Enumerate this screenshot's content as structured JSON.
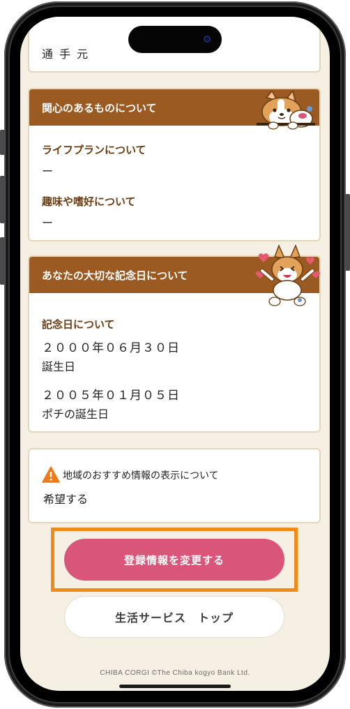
{
  "top_partial_text": "通 手 元",
  "interests_card": {
    "title": "関心のあるものについて",
    "items": [
      {
        "label": "ライフプランについて",
        "value": "ー"
      },
      {
        "label": "趣味や嗜好について",
        "value": "ー"
      }
    ]
  },
  "anniversary_card": {
    "title": "あなたの大切な記念日について",
    "label": "記念日について",
    "entries": [
      {
        "date": "２０００年０６月３０日",
        "name": "誕生日"
      },
      {
        "date": "２００５年０１月０５日",
        "name": "ポチの誕生日"
      }
    ]
  },
  "region_card": {
    "label": "地域のおすすめ情報の表示について",
    "value": "希望する"
  },
  "buttons": {
    "primary": "登録情報を変更する",
    "secondary": "生活サービス　トップ"
  },
  "footer": "CHIBA CORGI ©The Chiba kogyo Bank Ltd.",
  "colors": {
    "background": "#f6efe3",
    "card_header": "#9a5a22",
    "label": "#6a3d12",
    "primary_button": "#d9557a",
    "highlight": "#f28a18",
    "warning": "#f07a1a"
  }
}
